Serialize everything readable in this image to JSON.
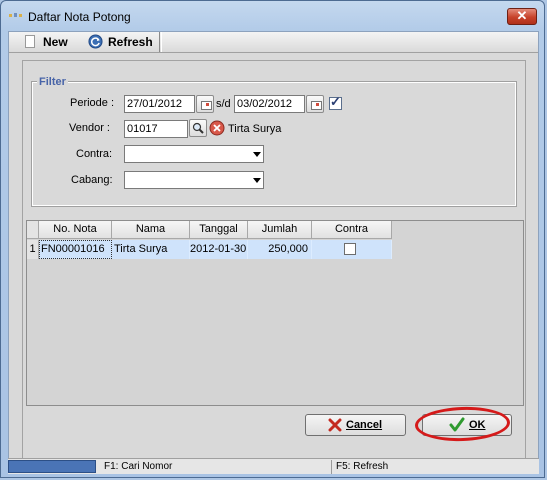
{
  "window": {
    "title": "Daftar Nota Potong",
    "close_glyph": "✕"
  },
  "toolbar": {
    "new_label": "New",
    "new_hotkey": "N",
    "refresh_label": "Refresh",
    "refresh_hotkey": "R"
  },
  "filter": {
    "legend": "Filter",
    "periode_label": "Periode :",
    "date_from": "27/01/2012",
    "sd_label": "s/d",
    "date_to": "03/02/2012",
    "periode_checked": true,
    "vendor_label": "Vendor :",
    "vendor_code": "01017",
    "vendor_name": "Tirta Surya",
    "contra_label": "Contra:",
    "contra_value": "",
    "cabang_label": "Cabang:",
    "cabang_value": ""
  },
  "grid": {
    "columns": [
      "No. Nota",
      "Nama",
      "Tanggal",
      "Jumlah",
      "Contra"
    ],
    "rows": [
      {
        "row_number": "1",
        "no_nota": "FN00001016",
        "nama": "Tirta Surya",
        "tanggal": "2012-01-30",
        "jumlah": "250,000",
        "contra": false
      }
    ]
  },
  "buttons": {
    "cancel_label": "Cancel",
    "ok_label": "OK"
  },
  "status": {
    "f1": "F1: Cari Nomor",
    "f5": "F5: Refresh"
  },
  "colors": {
    "title_accent": "#4864a8",
    "selection": "#cfe3fb",
    "highlight_ring": "#d51a1a"
  }
}
